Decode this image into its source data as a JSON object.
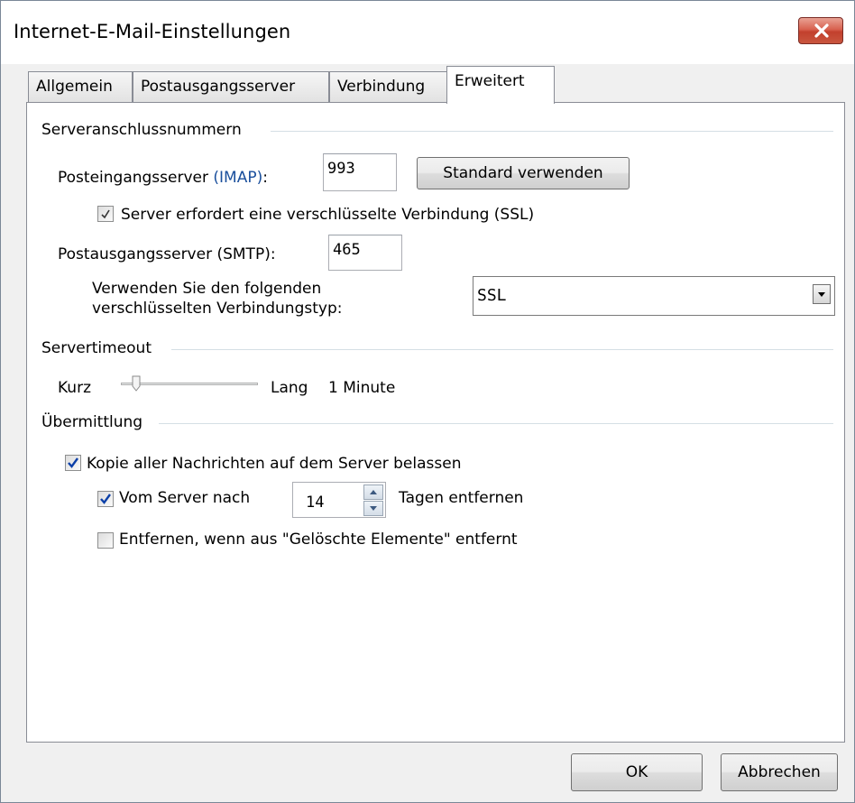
{
  "window": {
    "title": "Internet-E-Mail-Einstellungen",
    "close_icon": "close-icon"
  },
  "tabs": [
    {
      "label": "Allgemein",
      "active": false
    },
    {
      "label": "Postausgangsserver",
      "active": false
    },
    {
      "label": "Verbindung",
      "active": false
    },
    {
      "label": "Erweitert",
      "active": true
    }
  ],
  "ports": {
    "section_title": "Serveranschlussnummern",
    "incoming_label": "Posteingangsserver (IMAP):",
    "incoming_value": "993",
    "default_button": "Standard verwenden",
    "ssl_checkbox_label": "Server erfordert eine verschlüsselte Verbindung (SSL)",
    "ssl_checked": true,
    "outgoing_label": "Postausgangsserver (SMTP):",
    "outgoing_value": "465",
    "encryption_label_line1": "Verwenden Sie den folgenden",
    "encryption_label_line2": "verschlüsselten Verbindungstyp:",
    "encryption_value": "SSL"
  },
  "timeout": {
    "section_title": "Servertimeout",
    "short_label": "Kurz",
    "long_label": "Lang",
    "value_text": "1 Minute",
    "slider_level": 0.1
  },
  "delivery": {
    "section_title": "Übermittlung",
    "keep_copy_label": "Kopie aller Nachrichten auf dem Server belassen",
    "keep_copy_checked": true,
    "remove_after_label": "Vom Server nach",
    "remove_after_checked": true,
    "days_value": "14",
    "days_suffix": "Tagen entfernen",
    "remove_deleted_label": "Entfernen, wenn aus \"Gelöschte Elemente\" entfernt",
    "remove_deleted_checked": false
  },
  "footer": {
    "ok_label": "OK",
    "cancel_label": "Abbrechen"
  },
  "colors": {
    "accent_blue": "#0b3fa8",
    "imap_highlight": "#1a4f9c",
    "close_red": "#c9463d"
  }
}
